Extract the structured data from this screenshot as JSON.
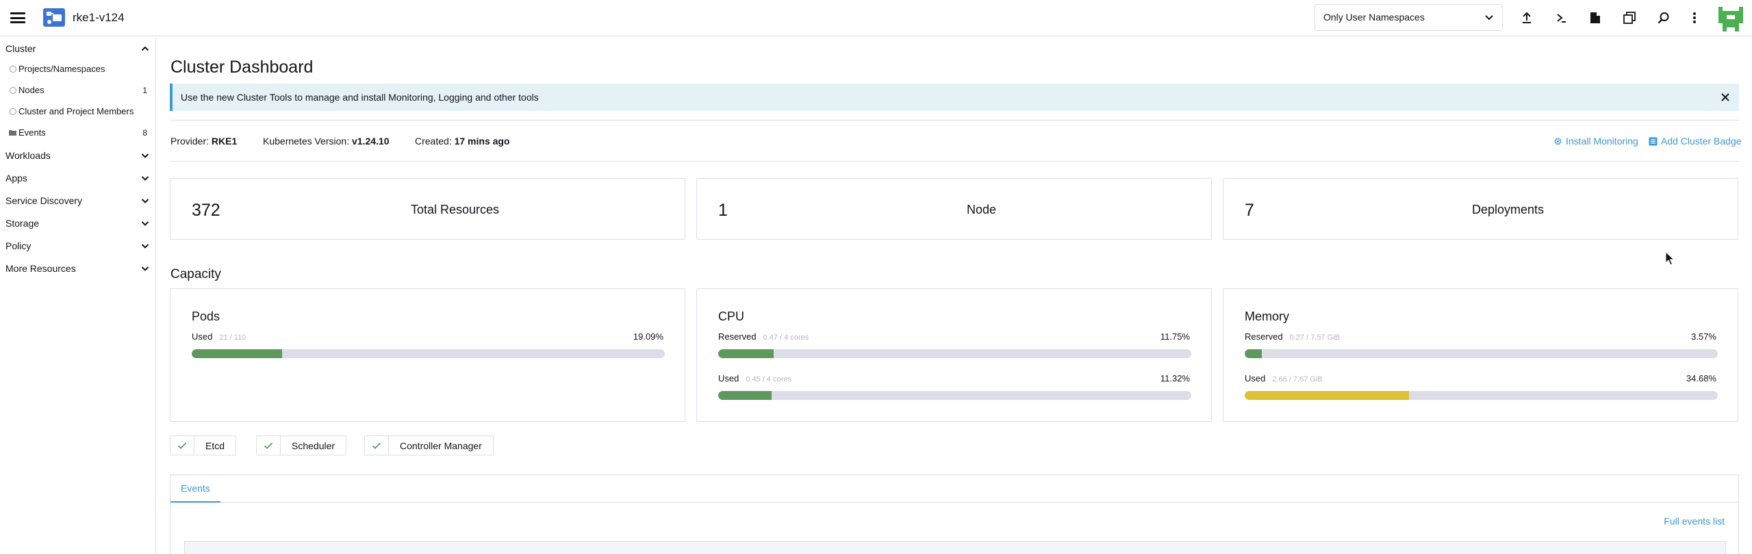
{
  "header": {
    "cluster_name": "rke1-v124",
    "namespace_filter": "Only User Namespaces",
    "icons": [
      "upload-icon",
      "kubectl-shell-icon",
      "kubeconfig-download-icon",
      "copy-kubeconfig-icon",
      "search-icon",
      "more-icon"
    ]
  },
  "sidebar": {
    "groups": [
      {
        "label": "Cluster",
        "expanded": true
      },
      {
        "label": "Workloads"
      },
      {
        "label": "Apps"
      },
      {
        "label": "Service Discovery"
      },
      {
        "label": "Storage"
      },
      {
        "label": "Policy"
      },
      {
        "label": "More Resources"
      }
    ],
    "cluster_items": [
      {
        "label": "Projects/Namespaces",
        "count": ""
      },
      {
        "label": "Nodes",
        "count": "1"
      },
      {
        "label": "Cluster and Project Members",
        "count": ""
      },
      {
        "label": "Events",
        "count": "8"
      }
    ]
  },
  "main": {
    "title": "Cluster Dashboard",
    "banner": "Use the new Cluster Tools to manage and install Monitoring, Logging and other tools",
    "provider_label": "Provider:",
    "provider_value": "RKE1",
    "k8s_label": "Kubernetes Version:",
    "k8s_value": "v1.24.10",
    "created_label": "Created:",
    "created_value": "17 mins ago",
    "install_monitoring": "Install Monitoring",
    "add_badge": "Add Cluster Badge",
    "counts": [
      {
        "value": "372",
        "label": "Total Resources"
      },
      {
        "value": "1",
        "label": "Node"
      },
      {
        "value": "7",
        "label": "Deployments"
      }
    ],
    "capacity_title": "Capacity",
    "pods": {
      "title": "Pods",
      "used_label": "Used",
      "used_sub": "21 / 110",
      "used_pct": "19.09%",
      "used_frac": 0.1909
    },
    "cpu": {
      "title": "CPU",
      "reserved_label": "Reserved",
      "reserved_sub": "0.47 / 4 cores",
      "reserved_pct": "11.75%",
      "reserved_frac": 0.1175,
      "used_label": "Used",
      "used_sub": "0.45 / 4 cores",
      "used_pct": "11.32%",
      "used_frac": 0.1132
    },
    "memory": {
      "title": "Memory",
      "reserved_label": "Reserved",
      "reserved_sub": "0.27 / 7.57 GiB",
      "reserved_pct": "3.57%",
      "reserved_frac": 0.0357,
      "used_label": "Used",
      "used_sub": "2.66 / 7.67 GiB",
      "used_pct": "34.68%",
      "used_frac": 0.3468
    },
    "components": [
      "Etcd",
      "Scheduler",
      "Controller Manager"
    ],
    "events_tab": "Events",
    "full_events": "Full events list",
    "colors": {
      "accent": "#3d98d3",
      "green": "#5d995d",
      "yellow": "#dbc135"
    }
  }
}
